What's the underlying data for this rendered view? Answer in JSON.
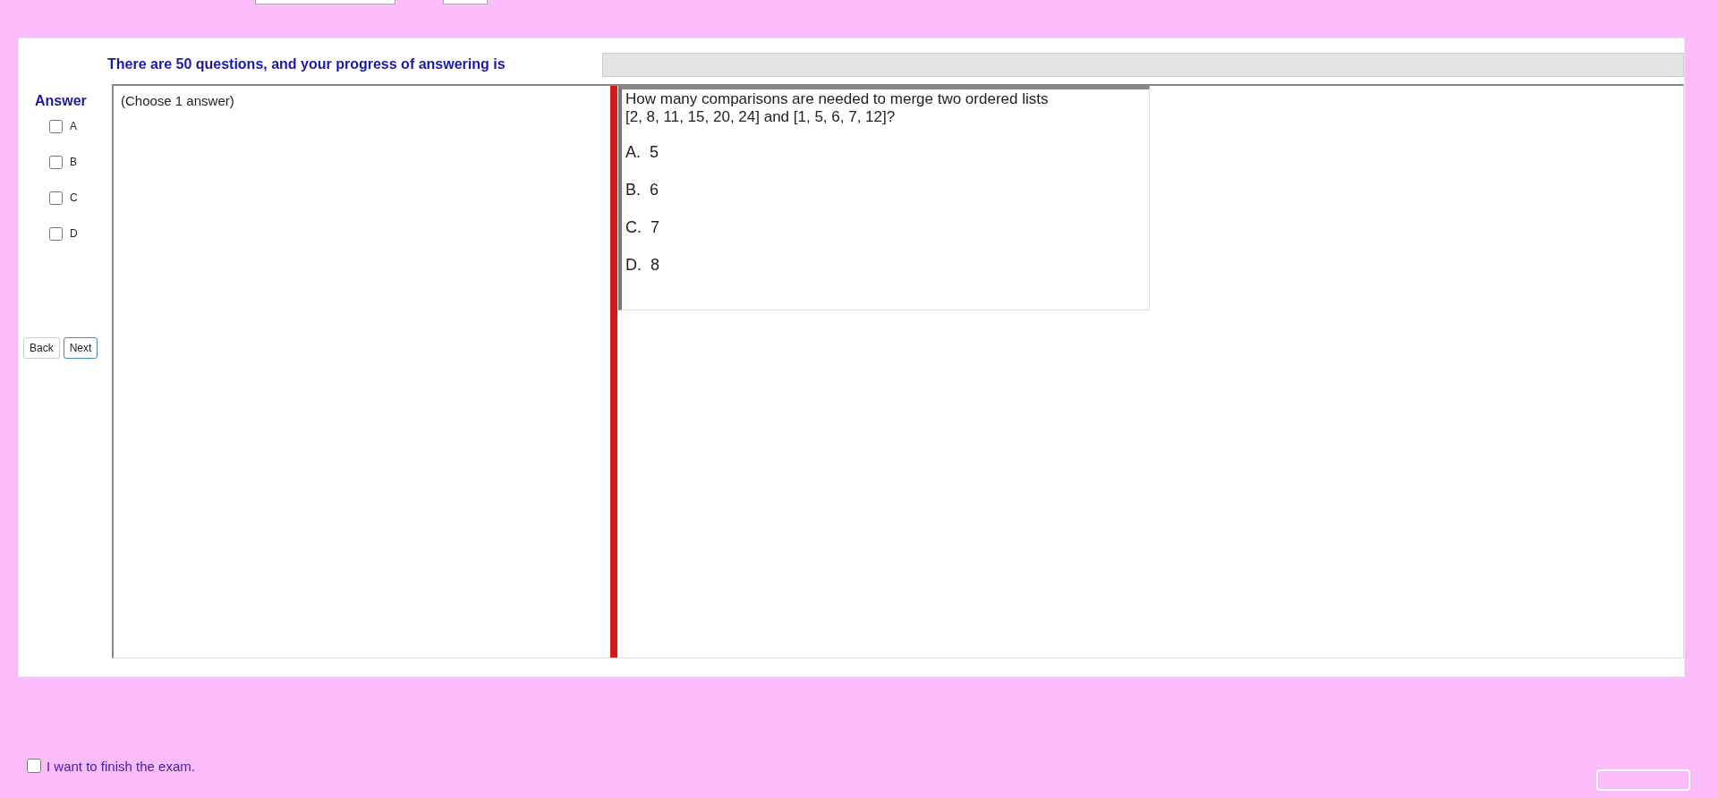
{
  "progress": {
    "text": "There are 50 questions, and your progress of answering is",
    "level": 0
  },
  "answer": {
    "heading": "Answer",
    "options": [
      {
        "label": "A",
        "checked": false
      },
      {
        "label": "B",
        "checked": false
      },
      {
        "label": "C",
        "checked": false
      },
      {
        "label": "D",
        "checked": false
      }
    ]
  },
  "nav_buttons": [
    "Back",
    "Next"
  ],
  "answer_pane": {
    "instruction": "(Choose 1 answer)"
  },
  "question": {
    "lines": [
      "How many comparisons are needed to merge two ordered lists",
      "[2, 8, 11, 15, 20, 24] and [1, 5, 6, 7, 12]?"
    ],
    "choices": [
      "A.  5",
      "B.  6",
      "C.  7",
      "D.  8"
    ]
  },
  "finish": {
    "label": "I want to finish the exam.",
    "checked": false
  }
}
